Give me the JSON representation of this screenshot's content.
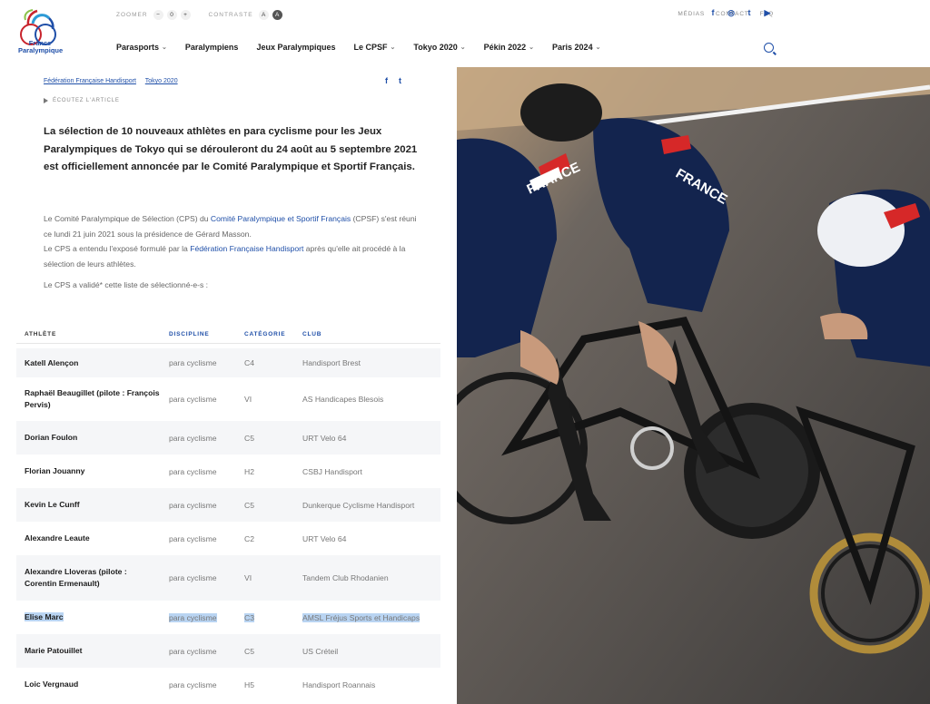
{
  "logo": {
    "line1": "France",
    "line2": "Paralympique"
  },
  "topbar": {
    "zoom_label": "ZOOMER",
    "zoom_minus": "−",
    "zoom_value": "0",
    "zoom_plus": "+",
    "contrast_label": "CONTRASTE",
    "contrast_a_light": "A",
    "contrast_a_dark": "A",
    "links": [
      "MÉDIAS",
      "CONTACT",
      "FAQ"
    ]
  },
  "social": [
    "f",
    "◎",
    "t",
    "▶"
  ],
  "nav": [
    {
      "label": "Parasports",
      "dropdown": true
    },
    {
      "label": "Paralympiens",
      "dropdown": false
    },
    {
      "label": "Jeux Paralympiques",
      "dropdown": false
    },
    {
      "label": "Le CPSF",
      "dropdown": true
    },
    {
      "label": "Tokyo 2020",
      "dropdown": true
    },
    {
      "label": "Pékin 2022",
      "dropdown": true
    },
    {
      "label": "Paris 2024",
      "dropdown": true
    }
  ],
  "article": {
    "tags": [
      "Fédération Française Handisport",
      "Tokyo 2020"
    ],
    "share": [
      "f",
      "t"
    ],
    "listen": "ÉCOUTEZ L'ARTICLE",
    "lead": "La sélection de 10 nouveaux athlètes en para cyclisme pour les Jeux Paralympiques de Tokyo qui se dérouleront du 24 août au 5 septembre 2021 est officiellement annoncée par le Comité Paralympique et Sportif Français.",
    "p1_pre": "Le Comité Paralympique de Sélection (CPS) du ",
    "p1_link": "Comité Paralympique et Sportif Français",
    "p1_post": " (CPSF) s'est réuni ce lundi 21 juin 2021 sous la présidence de Gérard Masson.",
    "p2_pre": "Le CPS a entendu l'exposé formulé par la ",
    "p2_link": "Fédération Française Handisport",
    "p2_post": " après qu'elle ait procédé à la sélection de leurs athlètes.",
    "p3": "Le CPS a validé* cette liste de sélectionné-e-s :"
  },
  "table": {
    "headers": [
      "ATHLÈTE",
      "DISCIPLINE",
      "CATÉGORIE",
      "CLUB"
    ],
    "rows": [
      {
        "athlete": "Katell Alençon",
        "discipline": "para cyclisme",
        "category": "C4",
        "club": "Handisport Brest"
      },
      {
        "athlete": "Raphaël Beaugillet (pilote : François Pervis)",
        "discipline": "para cyclisme",
        "category": "VI",
        "club": "AS Handicapes Blesois"
      },
      {
        "athlete": "Dorian Foulon",
        "discipline": "para cyclisme",
        "category": "C5",
        "club": "URT Velo 64"
      },
      {
        "athlete": "Florian Jouanny",
        "discipline": "para cyclisme",
        "category": "H2",
        "club": "CSBJ Handisport"
      },
      {
        "athlete": "Kevin Le Cunff",
        "discipline": "para cyclisme",
        "category": "C5",
        "club": "Dunkerque Cyclisme Handisport"
      },
      {
        "athlete": "Alexandre Leaute",
        "discipline": "para cyclisme",
        "category": "C2",
        "club": "URT Velo 64"
      },
      {
        "athlete": "Alexandre Lloveras (pilote : Corentin Ermenault)",
        "discipline": "para cyclisme",
        "category": "VI",
        "club": "Tandem Club Rhodanien"
      },
      {
        "athlete": "Elise Marc",
        "discipline": "para cyclisme",
        "category": "C3",
        "club": "AMSL Fréjus Sports et Handicaps"
      },
      {
        "athlete": "Marie Patouillet",
        "discipline": "para cyclisme",
        "category": "C5",
        "club": "US Créteil"
      },
      {
        "athlete": "Loic Vergnaud",
        "discipline": "para cyclisme",
        "category": "H5",
        "club": "Handisport Roannais"
      }
    ]
  },
  "photo": {
    "jersey_text": "FRANCE"
  },
  "colors": {
    "brand_blue": "#1f4fa8",
    "selection": "#b9d4f2",
    "row_alt": "#f5f6f8"
  }
}
